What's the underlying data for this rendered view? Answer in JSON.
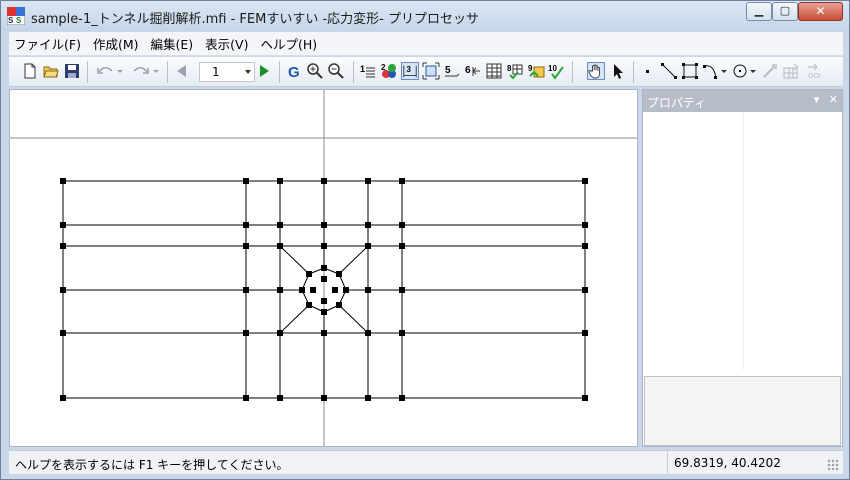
{
  "window": {
    "title": "sample-1_トンネル掘削解析.mfi - FEMすいすい -応力変形- プリプロセッサ",
    "app_icon": "fem-app-icon",
    "buttons": [
      "minimize",
      "maximize",
      "close"
    ]
  },
  "menu": [
    {
      "label": "ファイル(F)"
    },
    {
      "label": "作成(M)"
    },
    {
      "label": "編集(E)"
    },
    {
      "label": "表示(V)"
    },
    {
      "label": "ヘルプ(H)"
    }
  ],
  "toolbar": {
    "page_value": "1",
    "icons": [
      "new-file-icon",
      "open-folder-icon",
      "save-icon",
      "undo-icon",
      "redo-icon",
      "prev-icon",
      "page-dropdown",
      "next-icon",
      "g-icon",
      "zoom-in-icon",
      "zoom-out-icon",
      "node-number-icon",
      "color-icon",
      "dimension-icon",
      "fit-icon",
      "number-5-icon",
      "number-6-icon",
      "table-icon",
      "check-icon",
      "grid-icon",
      "number-10-icon",
      "hand-pan-icon",
      "pointer-icon",
      "point-icon",
      "line-icon",
      "rectangle-icon",
      "curve-icon",
      "circle-icon",
      "disabled-tool-1-icon",
      "disabled-tool-2-icon",
      "go-icon"
    ]
  },
  "properties": {
    "title": "プロパティ"
  },
  "status": {
    "help_text": "ヘルプを表示するには F1 キーを押してください。",
    "coords": "69.8319, 40.4202"
  },
  "colors": {
    "accent": "#1e5aa8",
    "mesh": "#000000",
    "axis": "#8c8c8c"
  }
}
